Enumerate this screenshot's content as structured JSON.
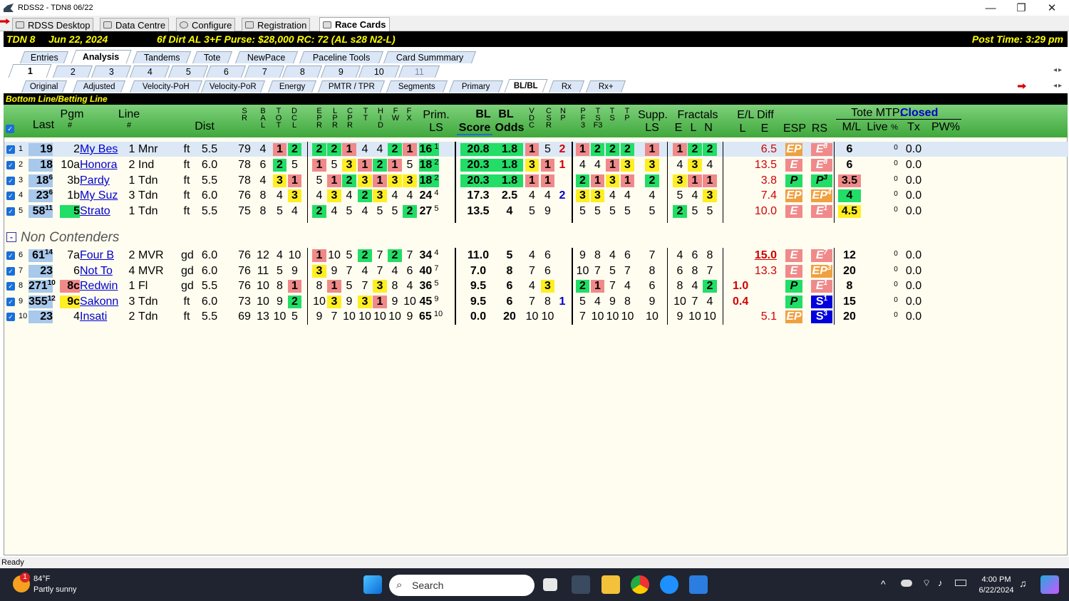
{
  "window": {
    "title": "RDSS2 - TDN8  06/22",
    "min": "—",
    "max": "❐",
    "close": "✕"
  },
  "app_tabs": [
    "RDSS Desktop",
    "Data Centre",
    "Configure",
    "Registration",
    "Race Cards"
  ],
  "race": {
    "track": "TDN  8",
    "date": "Jun 22, 2024",
    "conditions": "6f Dirt  AL  3+F  Purse: $28,000  RC: 72 (AL s28 N2-L)",
    "post_time": "Post Time: 3:29 pm"
  },
  "section_tabs": [
    "Entries",
    "Analysis",
    "Tandems",
    "Tote",
    "NewPace",
    "Paceline Tools",
    "Card Summmary"
  ],
  "race_tabs": [
    "1",
    "2",
    "3",
    "4",
    "5",
    "6",
    "7",
    "8",
    "9",
    "10",
    "11"
  ],
  "view_tabs": [
    "Original",
    "Adjusted",
    "Velocity-PoH",
    "Velocity-PoR",
    "Energy",
    "PMTR / TPR",
    "Segments",
    "Primary",
    "BL/BL",
    "Rx",
    "Rx+"
  ],
  "panel_title": "Bottom Line/Betting Line",
  "headers": {
    "last": "Last",
    "pgm": "Pgm",
    "pgm_sub": "#",
    "line": "Line",
    "line_sub": "#",
    "dist": "Dist",
    "sr": "S\nR",
    "bal": "B\nA\nL",
    "tot": "T\nO\nT",
    "dcl": "D\nC\nL",
    "epr": "E\nP\nR",
    "lpr": "L\nP\nR",
    "cpr": "C\nP\nR",
    "tt": "T\nT",
    "hid": "H\nI\nD",
    "fw": "F\nW",
    "fx": "F\nX",
    "prim": "Prim.",
    "prim_sub": "LS",
    "bl1": "BL",
    "bl2": "BL",
    "score": "Score",
    "odds": "Odds",
    "vdc": "V\nD\nC",
    "csr": "C\nS\nR",
    "np": "N\nP",
    "pf3": "P\nF\n3",
    "tsf3": "T\nS\nF3",
    "ts": "T\nS",
    "tp": "T\nP",
    "supp": "Supp.",
    "supp_sub": "LS",
    "fractals": "Fractals",
    "fe": "E",
    "fl": "L",
    "fn": "N",
    "eldiff": "E/L Diff",
    "el_l": "L",
    "el_e": "E",
    "esp": "ESP",
    "rs": "RS",
    "tote_mtp": "Tote MTP:",
    "tote_status": "Closed",
    "ml": "M/L",
    "live": "Live",
    "pct": "%",
    "tx": "Tx",
    "pw": "PW%"
  },
  "non_contenders_label": "Non Contenders",
  "rows": [
    {
      "n": "1",
      "last": "19",
      "lastsup": "",
      "pgm": "2",
      "name": "My Bes",
      "line": "1",
      "cls": "Mnr",
      "surf": "ft",
      "dist": "5.5",
      "sr": "79",
      "bal": "4",
      "tot": "1",
      "dcl": "2",
      "epr": "2",
      "lpr": "2",
      "cpr": "1",
      "tt": "4",
      "hid": "4",
      "fw": "2",
      "fx": "1",
      "prim": "16",
      "primsup": "1",
      "score": "20.8",
      "odds": "1.8",
      "vdc": "1",
      "csr": "5",
      "np": "2",
      "pf3": "1",
      "tsf3": "2",
      "ts": "2",
      "tp": "2",
      "supp": "1",
      "fe": "1",
      "fl": "2",
      "fn": "2",
      "ell": "",
      "ele": "6.5",
      "esp": "EP",
      "rs": "E",
      "rssup": "8",
      "ml": "6",
      "pct": "0",
      "tx": "0.0"
    },
    {
      "n": "2",
      "last": "18",
      "lastsup": "",
      "pgm": "10a",
      "name": "Honora",
      "line": "2",
      "cls": "Ind",
      "surf": "ft",
      "dist": "6.0",
      "sr": "78",
      "bal": "6",
      "tot": "2",
      "dcl": "5",
      "epr": "1",
      "lpr": "5",
      "cpr": "3",
      "tt": "1",
      "hid": "2",
      "fw": "1",
      "fx": "5",
      "prim": "18",
      "primsup": "2",
      "score": "20.3",
      "odds": "1.8",
      "vdc": "3",
      "csr": "1",
      "np": "1",
      "pf3": "4",
      "tsf3": "4",
      "ts": "1",
      "tp": "3",
      "supp": "3",
      "fe": "4",
      "fl": "3",
      "fn": "4",
      "ell": "",
      "ele": "13.5",
      "esp": "E",
      "rs": "E",
      "rssup": "8",
      "ml": "6",
      "pct": "0",
      "tx": "0.0"
    },
    {
      "n": "3",
      "last": "18",
      "lastsup": "6",
      "pgm": "3b",
      "name": "Pardy ",
      "line": "1",
      "cls": "Tdn",
      "surf": "ft",
      "dist": "5.5",
      "sr": "78",
      "bal": "4",
      "tot": "3",
      "dcl": "1",
      "epr": "5",
      "lpr": "1",
      "cpr": "2",
      "tt": "3",
      "hid": "1",
      "fw": "3",
      "fx": "3",
      "prim": "18",
      "primsup": "2",
      "score": "20.3",
      "odds": "1.8",
      "vdc": "1",
      "csr": "1",
      "np": "",
      "pf3": "2",
      "tsf3": "1",
      "ts": "3",
      "tp": "1",
      "supp": "2",
      "fe": "3",
      "fl": "1",
      "fn": "1",
      "ell": "",
      "ele": "3.8",
      "esp": "P",
      "rs": "P",
      "rssup": "3",
      "ml": "3.5",
      "pct": "0",
      "tx": "0.0"
    },
    {
      "n": "4",
      "last": "23",
      "lastsup": "6",
      "pgm": "1b",
      "name": "My Suz",
      "line": "3",
      "cls": "Tdn",
      "surf": "ft",
      "dist": "6.0",
      "sr": "76",
      "bal": "8",
      "tot": "4",
      "dcl": "3",
      "epr": "4",
      "lpr": "3",
      "cpr": "4",
      "tt": "2",
      "hid": "3",
      "fw": "4",
      "fx": "4",
      "prim": "24",
      "primsup": "4",
      "score": "17.3",
      "odds": "2.5",
      "vdc": "4",
      "csr": "4",
      "np": "2",
      "pf3": "3",
      "tsf3": "3",
      "ts": "4",
      "tp": "4",
      "supp": "4",
      "fe": "5",
      "fl": "4",
      "fn": "3",
      "ell": "",
      "ele": "7.4",
      "esp": "EP",
      "rs": "EP",
      "rssup": "4",
      "ml": "4",
      "pct": "0",
      "tx": "0.0"
    },
    {
      "n": "5",
      "last": "58",
      "lastsup": "11",
      "pgm": "5",
      "name": "Strato",
      "line": "1",
      "cls": "Tdn",
      "surf": "ft",
      "dist": "5.5",
      "sr": "75",
      "bal": "8",
      "tot": "5",
      "dcl": "4",
      "epr": "2",
      "lpr": "4",
      "cpr": "5",
      "tt": "4",
      "hid": "5",
      "fw": "5",
      "fx": "2",
      "prim": "27",
      "primsup": "5",
      "score": "13.5",
      "odds": "4",
      "vdc": "5",
      "csr": "9",
      "np": "",
      "pf3": "5",
      "tsf3": "5",
      "ts": "5",
      "tp": "5",
      "supp": "5",
      "fe": "2",
      "fl": "5",
      "fn": "5",
      "ell": "",
      "ele": "10.0",
      "esp": "E",
      "rs": "E",
      "rssup": "1",
      "ml": "4.5",
      "pct": "0",
      "tx": "0.0"
    },
    {
      "n": "6",
      "last": "61",
      "lastsup": "14",
      "pgm": "7a",
      "name": "Four B",
      "line": "2",
      "cls": "MVR",
      "surf": "gd",
      "dist": "6.0",
      "sr": "76",
      "bal": "12",
      "tot": "4",
      "dcl": "10",
      "epr": "1",
      "lpr": "10",
      "cpr": "5",
      "tt": "2",
      "hid": "7",
      "fw": "2",
      "fx": "7",
      "prim": "34",
      "primsup": "4",
      "score": "11.0",
      "odds": "5",
      "vdc": "4",
      "csr": "6",
      "np": "",
      "pf3": "9",
      "tsf3": "8",
      "ts": "4",
      "tp": "6",
      "supp": "7",
      "fe": "4",
      "fl": "6",
      "fn": "8",
      "ell": "",
      "ele": "15.0",
      "esp": "E",
      "rs": "E",
      "rssup": "7",
      "ml": "12",
      "pct": "0",
      "tx": "0.0"
    },
    {
      "n": "7",
      "last": "23",
      "lastsup": "",
      "pgm": "6",
      "name": "Not To",
      "line": "4",
      "cls": "MVR",
      "surf": "gd",
      "dist": "6.0",
      "sr": "76",
      "bal": "11",
      "tot": "5",
      "dcl": "9",
      "epr": "3",
      "lpr": "9",
      "cpr": "7",
      "tt": "4",
      "hid": "7",
      "fw": "4",
      "fx": "6",
      "prim": "40",
      "primsup": "7",
      "score": "7.0",
      "odds": "8",
      "vdc": "7",
      "csr": "6",
      "np": "",
      "pf3": "10",
      "tsf3": "7",
      "ts": "5",
      "tp": "7",
      "supp": "8",
      "fe": "6",
      "fl": "8",
      "fn": "7",
      "ell": "",
      "ele": "13.3",
      "esp": "E",
      "rs": "EP",
      "rssup": "3",
      "ml": "20",
      "pct": "0",
      "tx": "0.0"
    },
    {
      "n": "8",
      "last": "271",
      "lastsup": "10",
      "pgm": "8c",
      "name": "Redwin",
      "line": "1",
      "cls": "Fl",
      "surf": "gd",
      "dist": "5.5",
      "sr": "76",
      "bal": "10",
      "tot": "8",
      "dcl": "1",
      "epr": "8",
      "lpr": "1",
      "cpr": "5",
      "tt": "7",
      "hid": "3",
      "fw": "8",
      "fx": "4",
      "prim": "36",
      "primsup": "5",
      "score": "9.5",
      "odds": "6",
      "vdc": "4",
      "csr": "3",
      "np": "",
      "pf3": "2",
      "tsf3": "1",
      "ts": "7",
      "tp": "4",
      "supp": "6",
      "fe": "8",
      "fl": "4",
      "fn": "2",
      "ell": "1.0",
      "ele": "",
      "esp": "P",
      "rs": "E",
      "rssup": "1",
      "ml": "8",
      "pct": "0",
      "tx": "0.0"
    },
    {
      "n": "9",
      "last": "355",
      "lastsup": "12",
      "pgm": "9c",
      "name": "Sakonn",
      "line": "3",
      "cls": "Tdn",
      "surf": "ft",
      "dist": "6.0",
      "sr": "73",
      "bal": "10",
      "tot": "9",
      "dcl": "2",
      "epr": "10",
      "lpr": "3",
      "cpr": "9",
      "tt": "3",
      "hid": "1",
      "fw": "9",
      "fx": "10",
      "prim": "45",
      "primsup": "9",
      "score": "9.5",
      "odds": "6",
      "vdc": "7",
      "csr": "8",
      "np": "1",
      "pf3": "5",
      "tsf3": "4",
      "ts": "9",
      "tp": "8",
      "supp": "9",
      "fe": "10",
      "fl": "7",
      "fn": "4",
      "ell": "0.4",
      "ele": "",
      "esp": "P",
      "rs": "S",
      "rssup": "1",
      "ml": "15",
      "pct": "0",
      "tx": "0.0"
    },
    {
      "n": "10",
      "last": "23",
      "lastsup": "",
      "pgm": "4",
      "name": "Insati",
      "line": "2",
      "cls": "Tdn",
      "surf": "ft",
      "dist": "5.5",
      "sr": "69",
      "bal": "13",
      "tot": "10",
      "dcl": "5",
      "epr": "9",
      "lpr": "7",
      "cpr": "10",
      "tt": "10",
      "hid": "10",
      "fw": "10",
      "fx": "9",
      "prim": "65",
      "primsup": "10",
      "score": "0.0",
      "odds": "20",
      "vdc": "10",
      "csr": "10",
      "np": "",
      "pf3": "7",
      "tsf3": "10",
      "ts": "10",
      "tp": "10",
      "supp": "10",
      "fe": "9",
      "fl": "10",
      "fn": "10",
      "ell": "",
      "ele": "5.1",
      "esp": "EP",
      "rs": "S",
      "rssup": "3",
      "ml": "20",
      "pct": "0",
      "tx": "0.0"
    }
  ],
  "status": "Ready",
  "taskbar": {
    "weather_temp": "84°F",
    "weather_desc": "Partly sunny",
    "weather_badge": "1",
    "search": "Search",
    "time": "4:00 PM",
    "date": "6/22/2024"
  },
  "colors": {
    "green": "#22dd66",
    "yellow": "#ffee22",
    "pink": "#f08a8a",
    "orange": "#f0a040",
    "blue": "#0000dd",
    "header_green": "#3fa83c"
  }
}
